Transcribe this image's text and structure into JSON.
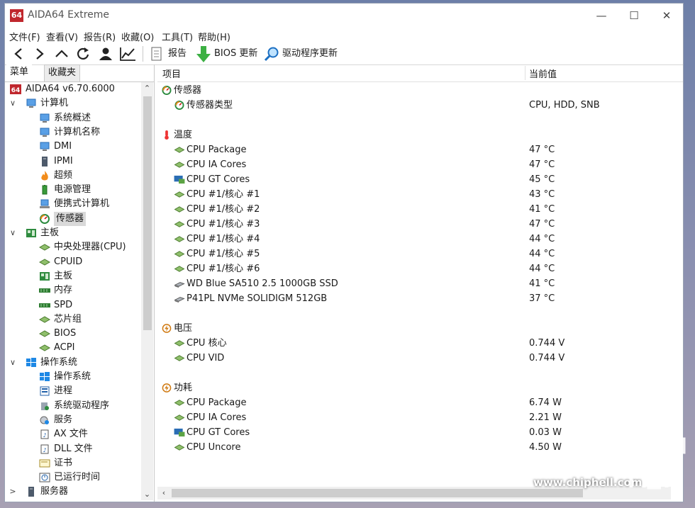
{
  "window": {
    "app_icon_text": "64",
    "title": "AIDA64 Extreme"
  },
  "menu": [
    "文件(F)",
    "查看(V)",
    "报告(R)",
    "收藏(O)",
    "工具(T)",
    "帮助(H)"
  ],
  "toolbar": {
    "report_label": "报告",
    "bios_label": "BIOS 更新",
    "driver_label": "驱动程序更新"
  },
  "left_tabs": {
    "menu": "菜单",
    "favorites": "收藏夹"
  },
  "tree": [
    {
      "label": "AIDA64 v6.70.6000",
      "icon": "aida64-icon",
      "level": 0,
      "expander": ""
    },
    {
      "label": "计算机",
      "icon": "computer-icon",
      "level": 1,
      "expander": "∨"
    },
    {
      "label": "系统概述",
      "icon": "computer-icon",
      "level": 2,
      "expander": ""
    },
    {
      "label": "计算机名称",
      "icon": "computer-icon",
      "level": 2,
      "expander": ""
    },
    {
      "label": "DMI",
      "icon": "computer-icon",
      "level": 2,
      "expander": ""
    },
    {
      "label": "IPMI",
      "icon": "server-icon",
      "level": 2,
      "expander": ""
    },
    {
      "label": "超频",
      "icon": "flame-icon",
      "level": 2,
      "expander": ""
    },
    {
      "label": "电源管理",
      "icon": "battery-icon",
      "level": 2,
      "expander": ""
    },
    {
      "label": "便携式计算机",
      "icon": "laptop-icon",
      "level": 2,
      "expander": ""
    },
    {
      "label": "传感器",
      "icon": "gauge-icon",
      "level": 2,
      "expander": "",
      "selected": true
    },
    {
      "label": "主板",
      "icon": "motherboard-icon",
      "level": 1,
      "expander": "∨"
    },
    {
      "label": "中央处理器(CPU)",
      "icon": "chip-icon",
      "level": 2,
      "expander": ""
    },
    {
      "label": "CPUID",
      "icon": "chip-icon",
      "level": 2,
      "expander": ""
    },
    {
      "label": "主板",
      "icon": "motherboard-icon",
      "level": 2,
      "expander": ""
    },
    {
      "label": "内存",
      "icon": "memory-icon",
      "level": 2,
      "expander": ""
    },
    {
      "label": "SPD",
      "icon": "memory-icon",
      "level": 2,
      "expander": ""
    },
    {
      "label": "芯片组",
      "icon": "chip-icon",
      "level": 2,
      "expander": ""
    },
    {
      "label": "BIOS",
      "icon": "chip-icon",
      "level": 2,
      "expander": ""
    },
    {
      "label": "ACPI",
      "icon": "chip-icon",
      "level": 2,
      "expander": ""
    },
    {
      "label": "操作系统",
      "icon": "windows-icon",
      "level": 1,
      "expander": "∨"
    },
    {
      "label": "操作系统",
      "icon": "windows-icon",
      "level": 2,
      "expander": ""
    },
    {
      "label": "进程",
      "icon": "process-icon",
      "level": 2,
      "expander": ""
    },
    {
      "label": "系统驱动程序",
      "icon": "driver-icon",
      "level": 2,
      "expander": ""
    },
    {
      "label": "服务",
      "icon": "service-icon",
      "level": 2,
      "expander": ""
    },
    {
      "label": "AX 文件",
      "icon": "file-icon",
      "level": 2,
      "expander": ""
    },
    {
      "label": "DLL 文件",
      "icon": "file-icon",
      "level": 2,
      "expander": ""
    },
    {
      "label": "证书",
      "icon": "certificate-icon",
      "level": 2,
      "expander": ""
    },
    {
      "label": "已运行时间",
      "icon": "clock-icon",
      "level": 2,
      "expander": ""
    },
    {
      "label": "服务器",
      "icon": "server-icon",
      "level": 1,
      "expander": ">"
    }
  ],
  "columns": {
    "item": "项目",
    "value": "当前值"
  },
  "rows": [
    {
      "kind": "group",
      "name": "传感器",
      "icon": "gauge-icon",
      "value": ""
    },
    {
      "kind": "item",
      "name": "传感器类型",
      "icon": "gauge-icon",
      "value": "CPU, HDD, SNB"
    },
    {
      "kind": "blank"
    },
    {
      "kind": "group",
      "name": "温度",
      "icon": "thermometer-icon",
      "value": ""
    },
    {
      "kind": "item",
      "name": "CPU Package",
      "icon": "chip-icon",
      "value": "47 °C"
    },
    {
      "kind": "item",
      "name": "CPU IA Cores",
      "icon": "chip-icon",
      "value": "47 °C"
    },
    {
      "kind": "item",
      "name": "CPU GT Cores",
      "icon": "gpu-icon",
      "value": "45 °C"
    },
    {
      "kind": "item",
      "name": "CPU #1/核心 #1",
      "icon": "chip-icon",
      "value": "43 °C"
    },
    {
      "kind": "item",
      "name": "CPU #1/核心 #2",
      "icon": "chip-icon",
      "value": "41 °C"
    },
    {
      "kind": "item",
      "name": "CPU #1/核心 #3",
      "icon": "chip-icon",
      "value": "47 °C"
    },
    {
      "kind": "item",
      "name": "CPU #1/核心 #4",
      "icon": "chip-icon",
      "value": "44 °C"
    },
    {
      "kind": "item",
      "name": "CPU #1/核心 #5",
      "icon": "chip-icon",
      "value": "44 °C"
    },
    {
      "kind": "item",
      "name": "CPU #1/核心 #6",
      "icon": "chip-icon",
      "value": "44 °C"
    },
    {
      "kind": "item",
      "name": "WD Blue SA510 2.5 1000GB SSD",
      "icon": "disk-icon",
      "value": "41 °C"
    },
    {
      "kind": "item",
      "name": "P41PL NVMe SOLIDIGM 512GB",
      "icon": "disk-icon",
      "value": "37 °C"
    },
    {
      "kind": "blank"
    },
    {
      "kind": "group",
      "name": "电压",
      "icon": "voltage-icon",
      "value": ""
    },
    {
      "kind": "item",
      "name": "CPU 核心",
      "icon": "chip-icon",
      "value": "0.744 V"
    },
    {
      "kind": "item",
      "name": "CPU VID",
      "icon": "chip-icon",
      "value": "0.744 V"
    },
    {
      "kind": "blank"
    },
    {
      "kind": "group",
      "name": "功耗",
      "icon": "voltage-icon",
      "value": ""
    },
    {
      "kind": "item",
      "name": "CPU Package",
      "icon": "chip-icon",
      "value": "6.74 W"
    },
    {
      "kind": "item",
      "name": "CPU IA Cores",
      "icon": "chip-icon",
      "value": "2.21 W"
    },
    {
      "kind": "item",
      "name": "CPU GT Cores",
      "icon": "gpu-icon",
      "value": "0.03 W"
    },
    {
      "kind": "item",
      "name": "CPU Uncore",
      "icon": "chip-icon",
      "value": "4.50 W"
    }
  ],
  "watermark": "www.chiphell.com"
}
